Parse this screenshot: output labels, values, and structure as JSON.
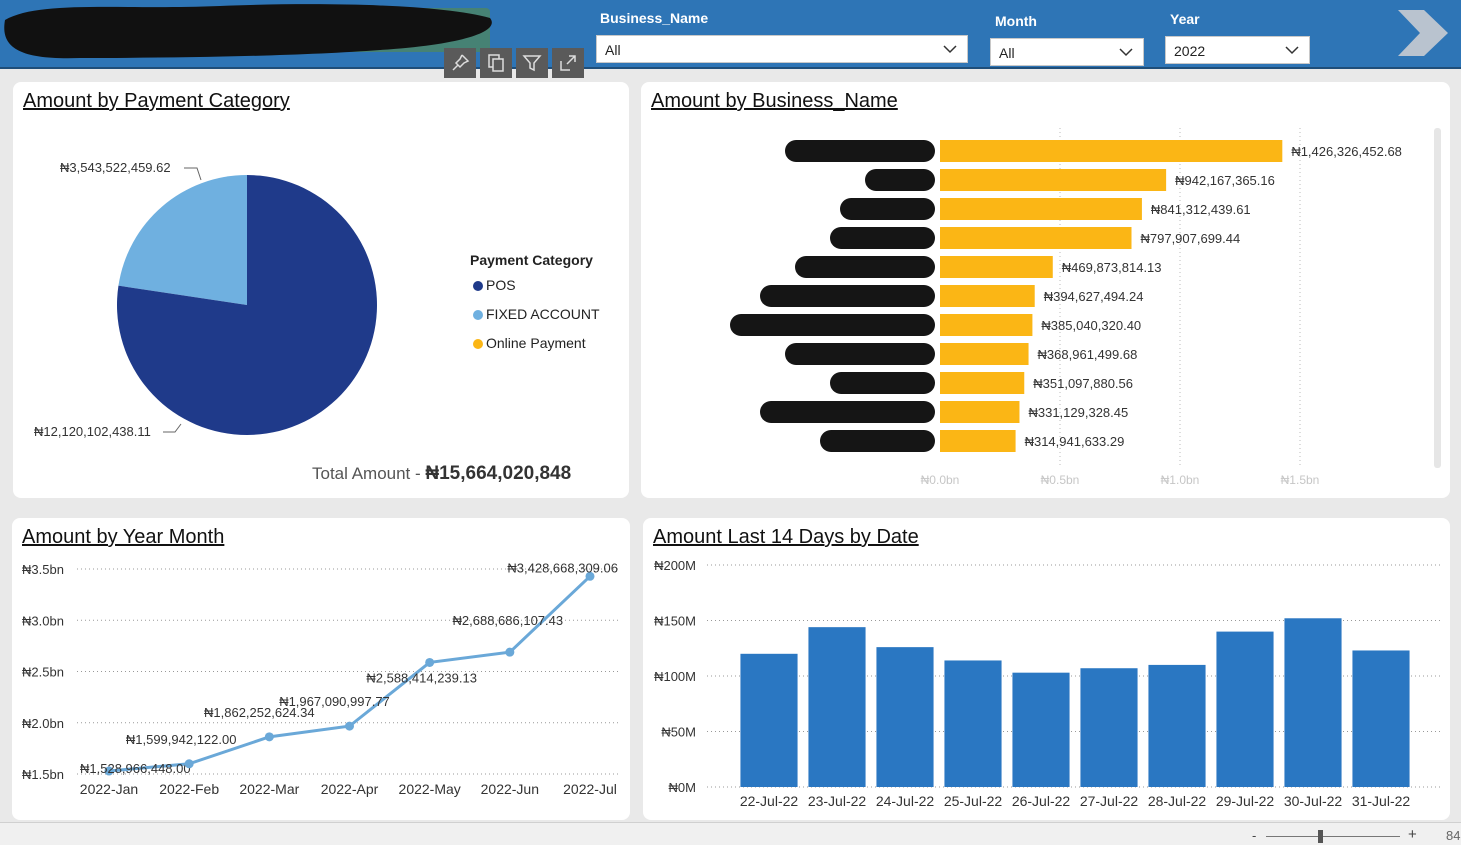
{
  "filters": {
    "business_name": {
      "label": "Business_Name",
      "value": "All"
    },
    "month": {
      "label": "Month",
      "value": "All"
    },
    "year": {
      "label": "Year",
      "value": "2022"
    }
  },
  "pie_card": {
    "title": "Amount by Payment Category",
    "legend_title": "Payment Category",
    "total_label": "Total Amount - ",
    "total_value": "₦15,664,020,848",
    "label_small": "₦3,543,522,459.62",
    "label_large": "₦12,120,102,438.11"
  },
  "bar_card": {
    "title": "Amount by Business_Name"
  },
  "line_card": {
    "title": "Amount by Year Month"
  },
  "col_card": {
    "title": "Amount Last 14 Days by Date"
  },
  "footer": {
    "zoom_text": "84"
  },
  "colors": {
    "pos": "#1f3a8a",
    "fixed_account": "#6fb0e0",
    "online_payment": "#fbb615",
    "bar": "#fbb615",
    "line": "#6aa8d8",
    "column": "#2a77c2",
    "header": "#2e75b6"
  },
  "chart_data": [
    {
      "type": "pie",
      "title": "Amount by Payment Category",
      "legend_title": "Payment Category",
      "series": [
        {
          "name": "POS",
          "value": 12120102438.11,
          "label": "₦12,120,102,438.11",
          "color": "#1f3a8a"
        },
        {
          "name": "FIXED ACCOUNT",
          "value": 3543522459.62,
          "label": "₦3,543,522,459.62",
          "color": "#6fb0e0"
        },
        {
          "name": "Online Payment",
          "value": 0,
          "label": "",
          "color": "#fbb615"
        }
      ]
    },
    {
      "type": "bar",
      "orientation": "horizontal",
      "title": "Amount by Business_Name",
      "values": [
        1426326452.68,
        942167365.16,
        841312439.61,
        797907699.44,
        469873814.13,
        394627494.24,
        385040320.4,
        368961499.68,
        351097880.56,
        331129328.45,
        314941633.29
      ],
      "value_labels": [
        "₦1,426,326,452.68",
        "₦942,167,365.16",
        "₦841,312,439.61",
        "₦797,907,699.44",
        "₦469,873,814.13",
        "₦394,627,494.24",
        "₦385,040,320.40",
        "₦368,961,499.68",
        "₦351,097,880.56",
        "₦331,129,328.45",
        "₦314,941,633.29"
      ],
      "xlim": [
        0,
        1500000000
      ],
      "xticks": [
        0,
        500000000,
        1000000000,
        1500000000
      ],
      "xtick_labels": [
        "₦0.0bn",
        "₦0.5bn",
        "₦1.0bn",
        "₦1.5bn"
      ],
      "category_labels_redacted": true
    },
    {
      "type": "line",
      "title": "Amount by Year Month",
      "categories": [
        "2022-Jan",
        "2022-Feb",
        "2022-Mar",
        "2022-Apr",
        "2022-May",
        "2022-Jun",
        "2022-Jul"
      ],
      "values": [
        1528966448.0,
        1599942122.0,
        1862252624.34,
        1967090997.77,
        2588414239.13,
        2688686107.43,
        3428668309.06
      ],
      "value_labels": [
        "₦1,528,966,448.00",
        "₦1,599,942,122.00",
        "₦1,862,252,624.34",
        "₦1,967,090,997.77",
        "₦2,588,414,239.13",
        "₦2,688,686,107.43",
        "₦3,428,668,309.06"
      ],
      "ylim": [
        1500000000,
        3500000000
      ],
      "yticks": [
        1500000000,
        2000000000,
        2500000000,
        3000000000,
        3500000000
      ],
      "ytick_labels": [
        "₦1.5bn",
        "₦2.0bn",
        "₦2.5bn",
        "₦3.0bn",
        "₦3.5bn"
      ]
    },
    {
      "type": "bar",
      "title": "Amount Last 14 Days by Date",
      "categories": [
        "22-Jul-22",
        "23-Jul-22",
        "24-Jul-22",
        "25-Jul-22",
        "26-Jul-22",
        "27-Jul-22",
        "28-Jul-22",
        "29-Jul-22",
        "30-Jul-22",
        "31-Jul-22"
      ],
      "values": [
        120000000,
        144000000,
        126000000,
        114000000,
        103000000,
        107000000,
        110000000,
        140000000,
        152000000,
        123000000
      ],
      "ylim": [
        0,
        200000000
      ],
      "yticks": [
        0,
        50000000,
        100000000,
        150000000,
        200000000
      ],
      "ytick_labels": [
        "₦0M",
        "₦50M",
        "₦100M",
        "₦150M",
        "₦200M"
      ]
    }
  ]
}
